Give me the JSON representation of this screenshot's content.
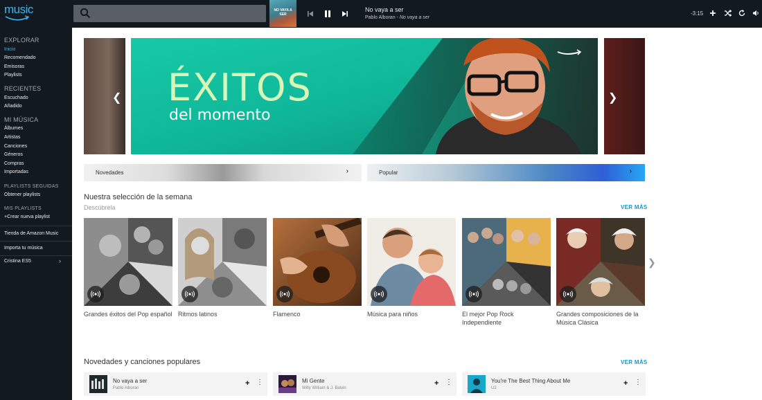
{
  "app": {
    "logo_text": "music"
  },
  "search": {
    "placeholder": ""
  },
  "now_playing": {
    "cover_text": "NO VAYA A SER",
    "title": "No vaya a ser",
    "artist": "Pablo Alboran -",
    "album": "No vaya a ser",
    "time": "-3:15"
  },
  "sidebar": {
    "explorar": "EXPLORAR",
    "explorar_items": [
      "Inicio",
      "Recomendado",
      "Emisoras",
      "Playlists"
    ],
    "recientes": "RECIENTES",
    "recientes_items": [
      "Escuchado",
      "Añadido"
    ],
    "mi_musica": "MI MÚSICA",
    "mi_musica_items": [
      "Álbumes",
      "Artistas",
      "Canciones",
      "Géneros",
      "Compras",
      "Importadas"
    ],
    "playlists_seguidas": "PLAYLISTS SEGUIDAS",
    "obtener_playlists": "Obtener playlists",
    "mis_playlists": "MIS PLAYLISTS",
    "crear_playlist": "+Crear nueva playlist",
    "tienda": "Tienda de Amazon Music",
    "importa": "Importa tu música",
    "user": "Cristina ES5"
  },
  "hero": {
    "title": "ÉXITOS",
    "subtitle": "del momento"
  },
  "categories": [
    {
      "label": "Novedades"
    },
    {
      "label": "Popular"
    }
  ],
  "seleccion": {
    "title": "Nuestra selección de la semana",
    "subtitle": "Descúbrela",
    "ver_mas": "VER MÁS",
    "stations": [
      {
        "label": "Grandes éxitos del Pop español"
      },
      {
        "label": "Ritmos latinos"
      },
      {
        "label": "Flamenco"
      },
      {
        "label": "Música para niños"
      },
      {
        "label": "El mejor Pop Rock Independiente"
      },
      {
        "label": "Grandes composiciones de la Música Clásica"
      }
    ]
  },
  "novedades": {
    "title": "Novedades y canciones populares",
    "ver_mas": "VER MÁS",
    "songs": [
      {
        "title": "No vaya a ser",
        "artist": "Pablo Alboran"
      },
      {
        "title": "Mi Gente",
        "artist": "Willy William & J. Balvin"
      },
      {
        "title": "You're The Best Thing About Me",
        "artist": "U2"
      }
    ]
  },
  "colors": {
    "accent": "#3eb4e8",
    "link": "#1895c8",
    "dark": "#131921"
  }
}
